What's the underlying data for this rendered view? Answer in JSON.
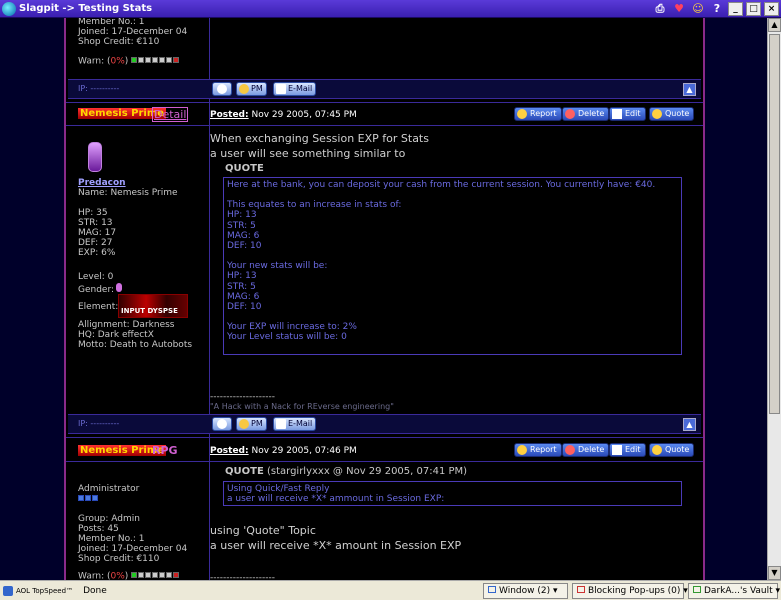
{
  "window": {
    "title": "Slagpit -> Testing Stats",
    "controls": [
      "_",
      "□",
      "×"
    ]
  },
  "post1_tail": {
    "member_no": "Member No.: 1",
    "joined": "Joined: 17-December 04",
    "shop_credit": "Shop Credit: €110",
    "warn_label": "Warn: (",
    "warn_value": "0%",
    "warn_close": ")",
    "ip": "IP: ----------"
  },
  "buttons": {
    "profile": "",
    "pm": "PM",
    "email": "E-Mail",
    "report": "Report",
    "delete": "Delete",
    "edit": "Edit",
    "quote": "Quote"
  },
  "post2": {
    "author": "Nemesis Prime",
    "detail_link": "Detail",
    "posted_label": "Posted:",
    "posted_date": "Nov 29 2005, 07:45 PM",
    "group_link": "Predacon",
    "profile_lines": [
      "Name: Nemesis Prime",
      "",
      "HP: 35",
      "STR: 13",
      "MAG: 17",
      "DEF: 27",
      "EXP: 6%"
    ],
    "level": "Level: 0",
    "gender": "Gender:",
    "element": "Element:",
    "element_img_text": "INPUT DYSPSE",
    "allignment": "Allignment: Darkness",
    "hq": "HQ: Dark effectX",
    "motto": "Motto: Death to Autobots",
    "body_line1": "When exchanging Session EXP for Stats",
    "body_line2": "a user will see something similar to",
    "quote_label": "QUOTE",
    "quote_lines": [
      "Here at the bank, you can deposit your cash from the current session. You currently have: €40.",
      "",
      "This equates to an increase in stats of:",
      "HP: 13",
      "STR: 5",
      "MAG: 6",
      "DEF: 10",
      "",
      "Your new stats will be:",
      "HP: 13",
      "STR: 5",
      "MAG: 6",
      "DEF: 10",
      "",
      "Your EXP will increase to: 2%",
      "Your Level status will be: 0"
    ],
    "sig_line": "--------------------",
    "sig_text": "\"A Hack with a Nack for REverse engineering\"",
    "ip": "IP: ----------"
  },
  "post3": {
    "author": "Nemesis Prime",
    "group_link": "RPG",
    "posted_label": "Posted:",
    "posted_date": "Nov 29 2005, 07:46 PM",
    "role": "Administrator",
    "group": "Group: Admin",
    "posts": "Posts: 45",
    "member_no": "Member No.: 1",
    "joined": "Joined: 17-December 04",
    "shop_credit": "Shop Credit: €110",
    "warn_label": "Warn: (",
    "warn_value": "0%",
    "warn_close": ")",
    "quote_label": "QUOTE",
    "quote_meta": "(stargirlyxxx @ Nov 29 2005, 07:41 PM)",
    "quote_lines": [
      "Using Quick/Fast Reply",
      "a user will receive *X* ammount in Session EXP:"
    ],
    "body_line1": "using 'Quote\" Topic",
    "body_line2": "a user will receive *X* amount in Session EXP",
    "sig_line": "--------------------"
  },
  "statusbar": {
    "brand": "AOL TopSpeed™",
    "status": "Done",
    "window_count": "Window (2)",
    "popups": "Blocking Pop-ups (0)",
    "vault": "DarkA...'s Vault"
  },
  "colors": {
    "accent": "#3a1fb0",
    "frame_border": "#8a2a8a",
    "table_line": "#3a2a9a",
    "quote_text": "#6a6ae0"
  }
}
